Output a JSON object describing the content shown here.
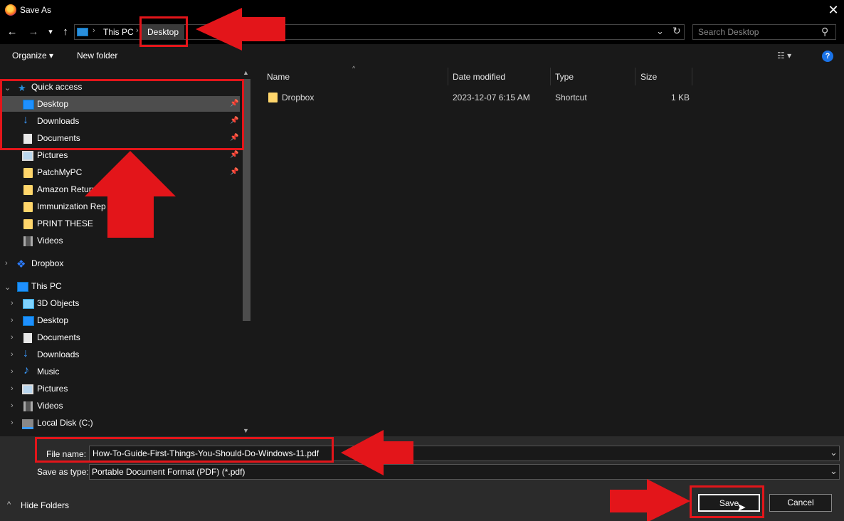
{
  "window": {
    "title": "Save As",
    "close_glyph": "✕"
  },
  "nav": {
    "back": "←",
    "forward": "→",
    "recent": "▾",
    "up": "↑",
    "breadcrumb": [
      "This PC",
      "Desktop"
    ],
    "breadcrumb_sep": "›",
    "dropdown": "⌄",
    "refresh": "↻",
    "search_placeholder": "Search Desktop",
    "search_icon": "⚲"
  },
  "toolbar": {
    "organize": "Organize ▾",
    "new_folder": "New folder",
    "view_icon": "☷ ▾",
    "help": "?"
  },
  "sidebar": {
    "quick_access": {
      "label": "Quick access",
      "items": [
        {
          "label": "Desktop",
          "icon": "desktop-icon",
          "pinned": true
        },
        {
          "label": "Downloads",
          "icon": "downloads-icon",
          "pinned": true
        },
        {
          "label": "Documents",
          "icon": "documents-icon",
          "pinned": true
        },
        {
          "label": "Pictures",
          "icon": "pictures-icon",
          "pinned": true
        },
        {
          "label": "PatchMyPC",
          "icon": "folder-icon",
          "pinned": true
        },
        {
          "label": "Amazon Returns",
          "icon": "folder-icon",
          "pinned": false
        },
        {
          "label": "Immunization Rep",
          "icon": "folder-icon",
          "pinned": false
        },
        {
          "label": "PRINT THESE",
          "icon": "folder-icon",
          "pinned": false
        },
        {
          "label": "Videos",
          "icon": "videos-icon",
          "pinned": false
        }
      ]
    },
    "dropbox": "Dropbox",
    "this_pc": {
      "label": "This PC",
      "items": [
        "3D Objects",
        "Desktop",
        "Documents",
        "Downloads",
        "Music",
        "Pictures",
        "Videos",
        "Local Disk (C:)"
      ]
    }
  },
  "columns": {
    "name": "Name",
    "date": "Date modified",
    "type": "Type",
    "size": "Size"
  },
  "files": [
    {
      "name": "Dropbox",
      "date": "2023-12-07 6:15 AM",
      "type": "Shortcut",
      "size": "1 KB"
    }
  ],
  "form": {
    "file_name_label": "File name:",
    "file_name": "How-To-Guide-First-Things-You-Should-Do-Windows-11.pdf",
    "type_label": "Save as type:",
    "type_value": "Portable Document Format (PDF) (*.pdf)",
    "hide_folders": "Hide Folders",
    "save": "Save",
    "cancel": "Cancel"
  },
  "colors": {
    "accent": "#e3151a",
    "selection": "#4d4d4d",
    "background": "#191919"
  }
}
